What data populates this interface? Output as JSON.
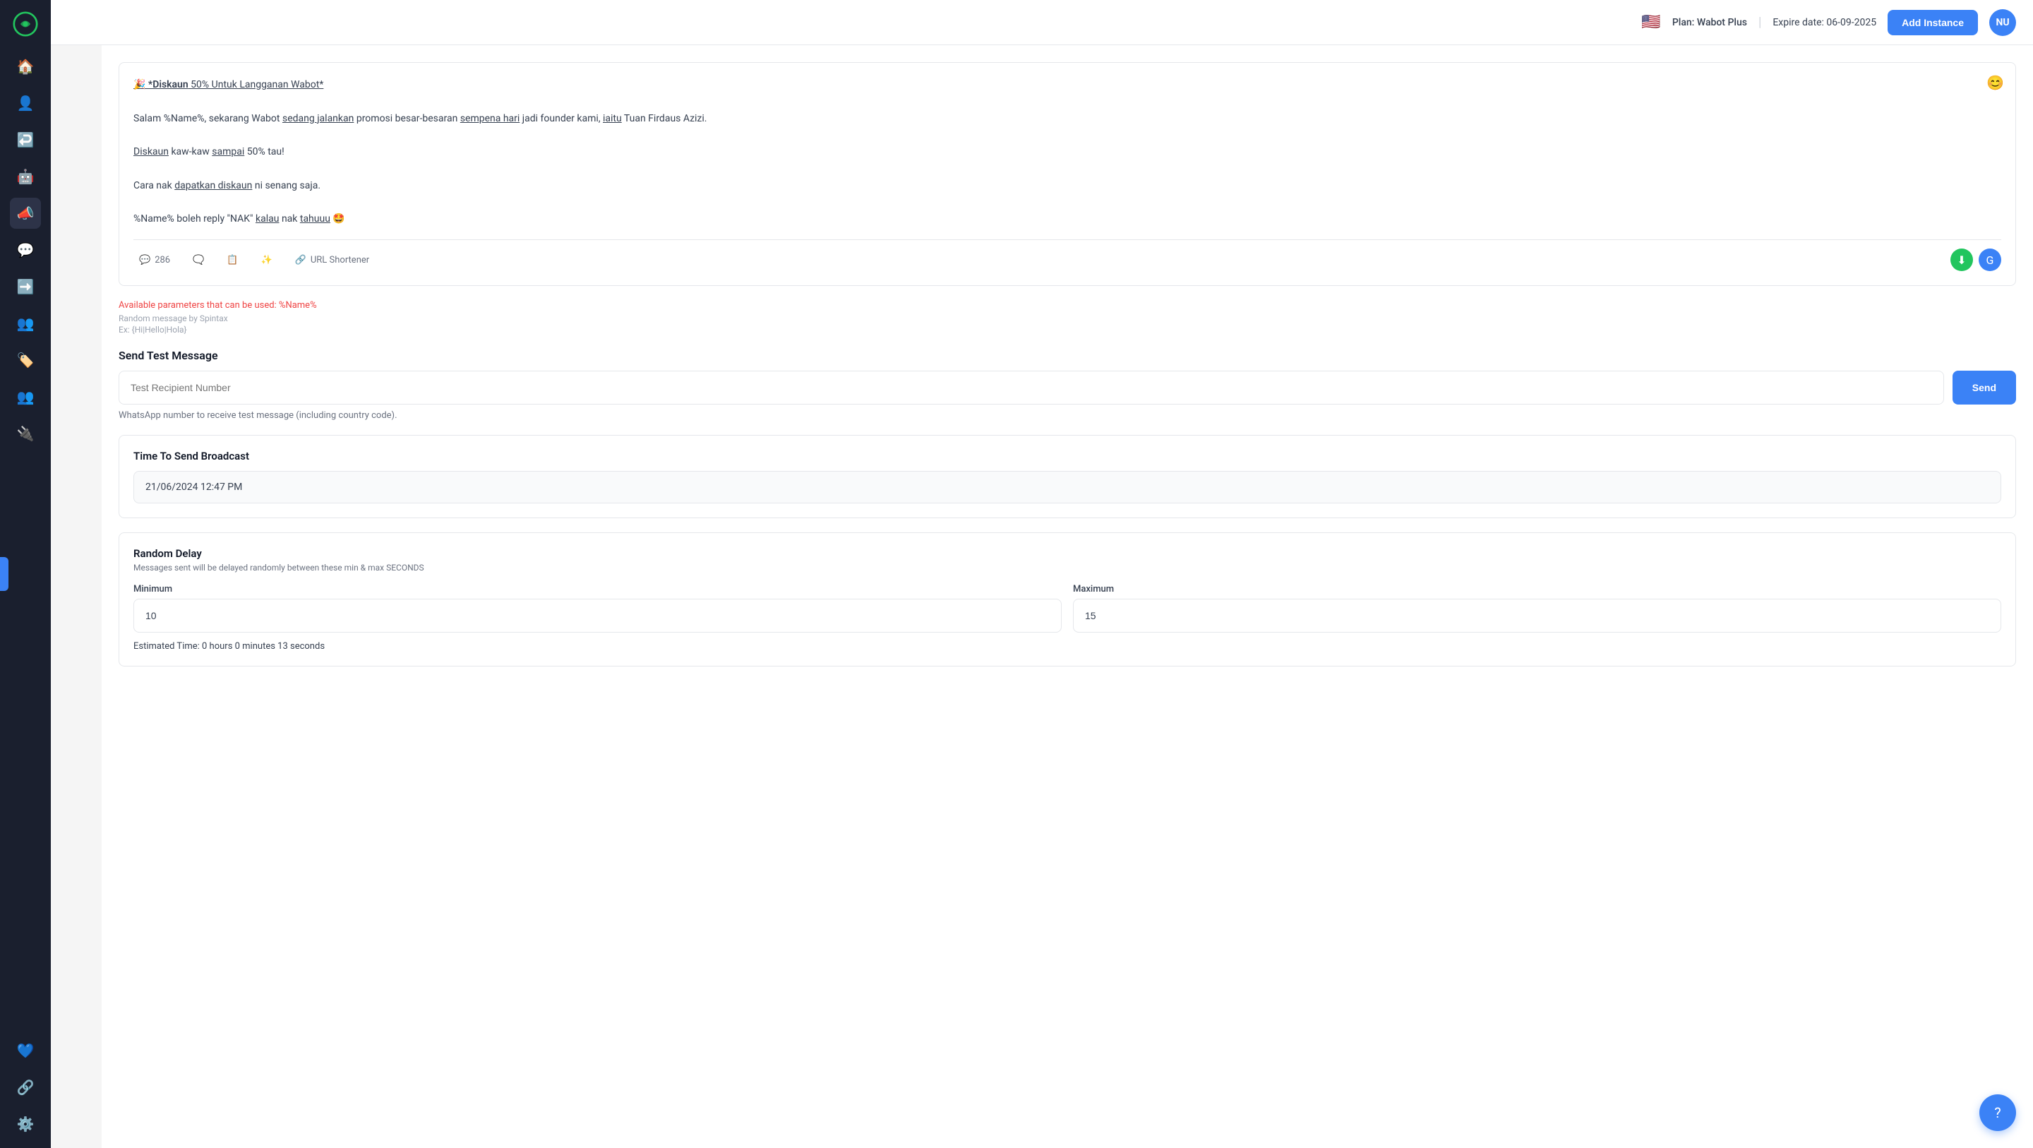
{
  "topbar": {
    "flag": "🇺🇸",
    "plan": "Plan: Wabot Plus",
    "divider": "|",
    "expire": "Expire date: 06-09-2025",
    "add_instance_label": "Add Instance",
    "avatar_initials": "NU"
  },
  "sidebar": {
    "items": [
      {
        "icon": "🏠",
        "label": "home",
        "active": false
      },
      {
        "icon": "👤",
        "label": "contacts",
        "active": false
      },
      {
        "icon": "↩",
        "label": "replies",
        "active": false
      },
      {
        "icon": "🤖",
        "label": "bot",
        "active": false
      },
      {
        "icon": "📣",
        "label": "broadcast",
        "active": true
      },
      {
        "icon": "💬",
        "label": "chat",
        "active": false
      },
      {
        "icon": "➡",
        "label": "export",
        "active": false
      },
      {
        "icon": "👥",
        "label": "team",
        "active": false
      },
      {
        "icon": "🏷",
        "label": "tags",
        "active": false
      },
      {
        "icon": "👥",
        "label": "groups",
        "active": false
      },
      {
        "icon": "🔌",
        "label": "integrations",
        "active": false
      },
      {
        "icon": "💙",
        "label": "support",
        "active": false
      },
      {
        "icon": "🔗",
        "label": "links",
        "active": false
      },
      {
        "icon": "⚙",
        "label": "settings",
        "active": false
      }
    ]
  },
  "message": {
    "line1_bold": "🎉 *Diskaun",
    "line1_rest": " 50% Untuk Langganan Wabot*",
    "line2": "Salam %Name%, sekarang Wabot sedang jalankan promosi besar-besaran sempena hari jadi founder kami, iaitu Tuan Firdaus Azizi.",
    "line3": "Diskaun kaw-kaw sampai 50% tau!",
    "line4": "Cara nak dapatkan diskaun ni senang saja.",
    "line5": "%Name% boleh reply \"NAK\" kalau nak tahuuu 🤩",
    "char_count": "286",
    "toolbar_items": [
      {
        "icon": "💬",
        "label": ""
      },
      {
        "icon": "📋",
        "label": ""
      },
      {
        "icon": "✨",
        "label": ""
      },
      {
        "icon": "🔗",
        "label": "URL Shortener"
      }
    ],
    "emoji_btn": "😊"
  },
  "params": {
    "available": "Available parameters that can be used: %Name%",
    "spintax": "Random message by Spintax",
    "example": "Ex: {Hi|Hello|Hola}"
  },
  "test_message": {
    "section_title": "Send Test Message",
    "placeholder": "Test Recipient Number",
    "send_label": "Send",
    "hint": "WhatsApp number to receive test message (including country code)."
  },
  "broadcast": {
    "section_title": "Time To Send Broadcast",
    "datetime_value": "21/06/2024 12:47 PM"
  },
  "random_delay": {
    "section_title": "Random Delay",
    "hint": "Messages sent will be delayed randomly between these min & max SECONDS",
    "minimum_label": "Minimum",
    "maximum_label": "Maximum",
    "minimum_value": "10",
    "maximum_value": "15",
    "estimated": "Estimated Time: 0 hours 0 minutes 13 seconds"
  },
  "help": {
    "icon": "?"
  }
}
